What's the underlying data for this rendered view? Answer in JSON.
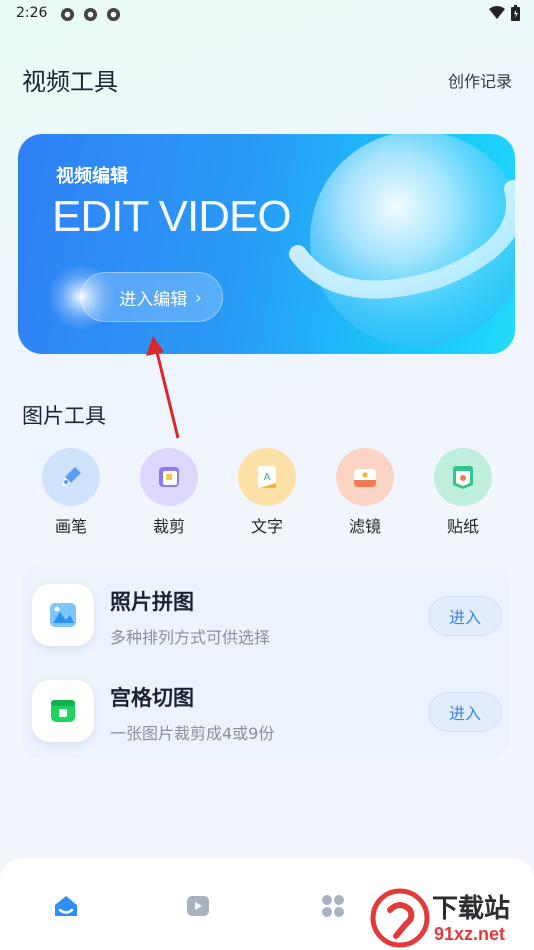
{
  "status": {
    "time": "2:26"
  },
  "header": {
    "title": "视频工具",
    "link": "创作记录"
  },
  "banner": {
    "subtitle": "视频编辑",
    "title": "EDIT VIDEO",
    "button_label": "进入编辑"
  },
  "image_tools": {
    "title": "图片工具",
    "items": [
      {
        "label": "画笔",
        "icon": "pen-icon",
        "color": "#5b9cf2"
      },
      {
        "label": "裁剪",
        "icon": "crop-icon",
        "color": "#8e7af5"
      },
      {
        "label": "文字",
        "icon": "text-icon",
        "color": "#f7b23a"
      },
      {
        "label": "滤镜",
        "icon": "filter-icon",
        "color": "#f07a55"
      },
      {
        "label": "贴纸",
        "icon": "sticker-icon",
        "color": "#34c48e"
      }
    ]
  },
  "cards": [
    {
      "title": "照片拼图",
      "desc": "多种排列方式可供选择",
      "button": "进入",
      "icon": "collage-icon"
    },
    {
      "title": "宫格切图",
      "desc": "一张图片裁剪成4或9份",
      "button": "进入",
      "icon": "grid-cut-icon"
    }
  ],
  "bottom_nav": [
    {
      "name": "home",
      "icon": "home-icon",
      "active": true
    },
    {
      "name": "video",
      "icon": "video-icon",
      "active": false
    },
    {
      "name": "apps",
      "icon": "apps-icon",
      "active": false
    },
    {
      "name": "profile",
      "icon": "profile-icon",
      "active": false
    }
  ],
  "watermark": {
    "line1": "下载站",
    "line2": "91xz.net"
  },
  "colors": {
    "accent": "#3a86e6",
    "annotation_arrow": "#d8262a"
  }
}
